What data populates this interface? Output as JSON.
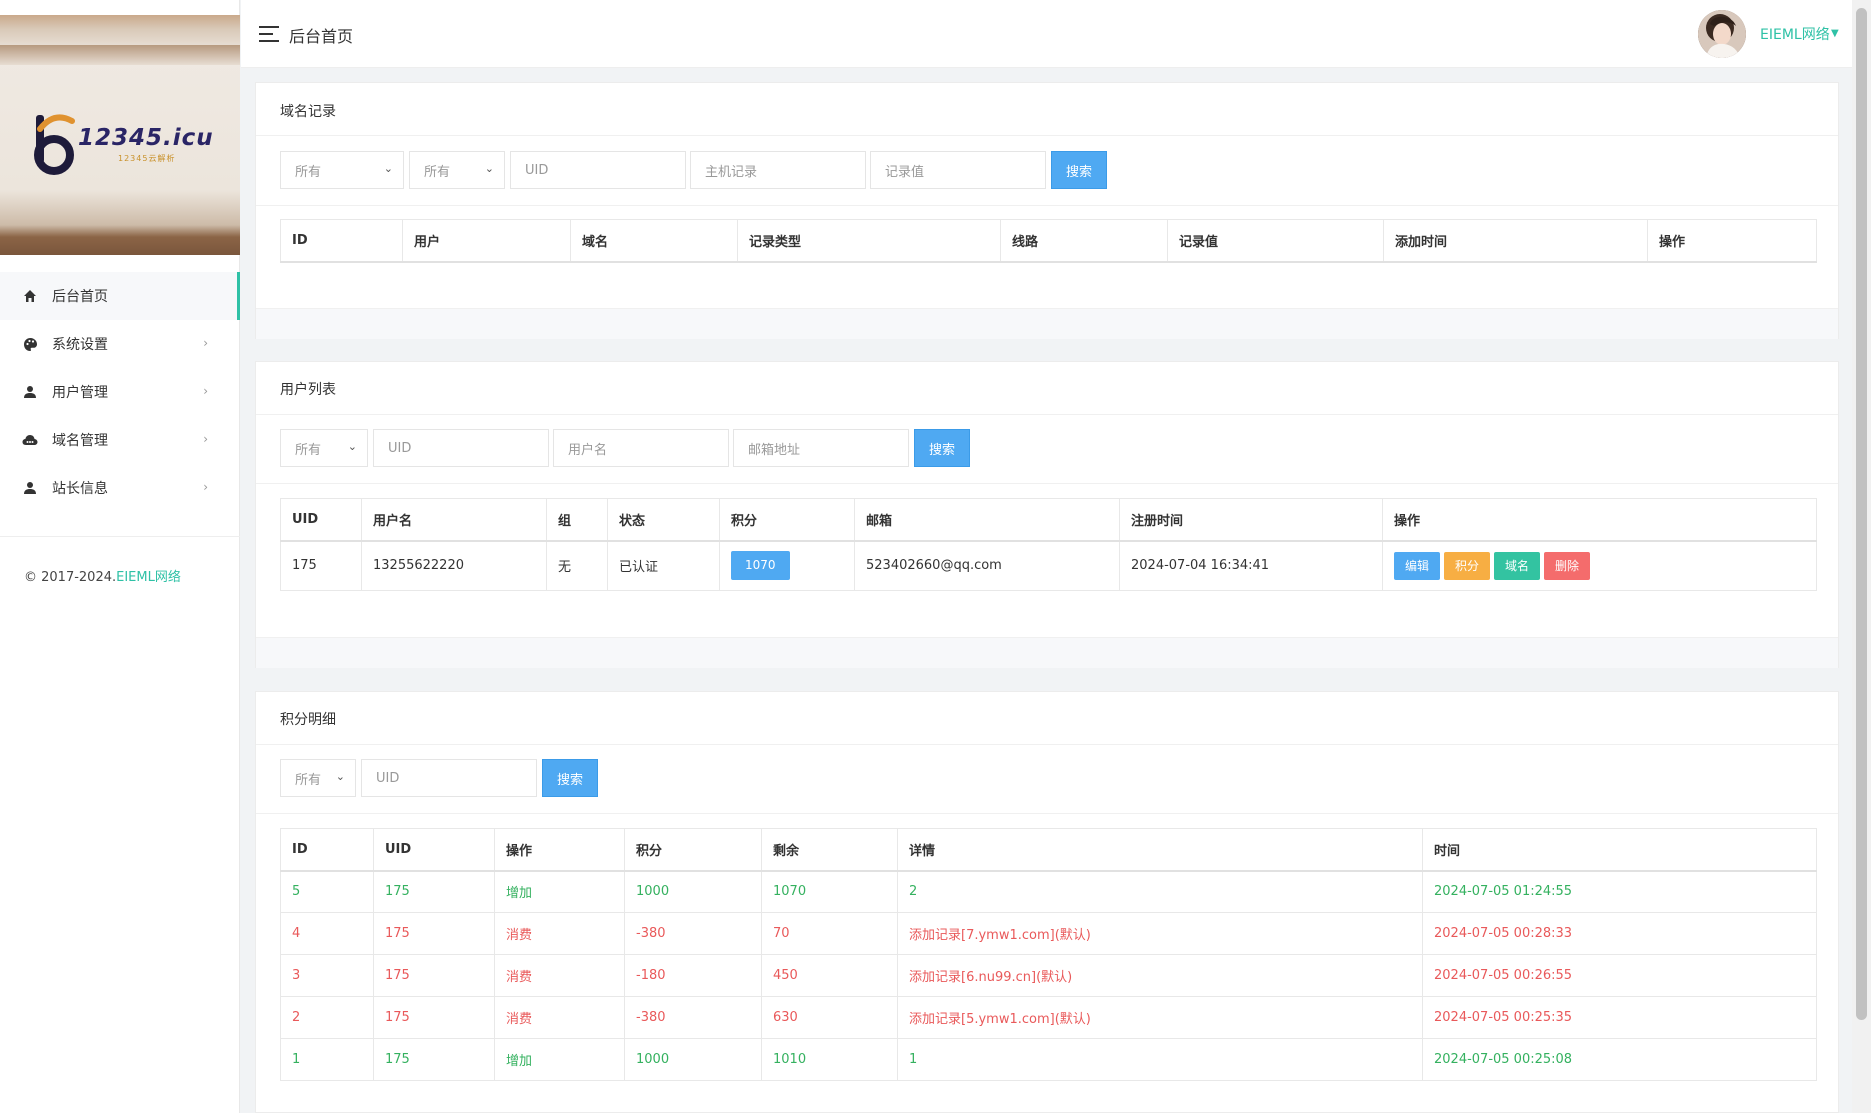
{
  "header": {
    "title": "后台首页",
    "user_name": "EIEML网络"
  },
  "logo": {
    "main": "12345.icu",
    "sub": "12345云解析"
  },
  "sidebar": {
    "items": [
      {
        "label": "后台首页",
        "icon": "home-icon",
        "active": true
      },
      {
        "label": "系统设置",
        "icon": "palette-icon"
      },
      {
        "label": "用户管理",
        "icon": "user-icon"
      },
      {
        "label": "域名管理",
        "icon": "cloud-icon"
      },
      {
        "label": "站长信息",
        "icon": "person-icon"
      }
    ],
    "copyright_prefix": "© 2017-2024.",
    "copyright_brand": "EIEML网络"
  },
  "domain_records": {
    "title": "域名记录",
    "filters": {
      "select1": "所有",
      "select2": "所有",
      "uid_placeholder": "UID",
      "host_placeholder": "主机记录",
      "value_placeholder": "记录值",
      "search_label": "搜索"
    },
    "columns": [
      "ID",
      "用户",
      "域名",
      "记录类型",
      "线路",
      "记录值",
      "添加时间",
      "操作"
    ],
    "rows": []
  },
  "user_list": {
    "title": "用户列表",
    "filters": {
      "select1": "所有",
      "uid_placeholder": "UID",
      "username_placeholder": "用户名",
      "email_placeholder": "邮箱地址",
      "search_label": "搜索"
    },
    "columns": [
      "UID",
      "用户名",
      "组",
      "状态",
      "积分",
      "邮箱",
      "注册时间",
      "操作"
    ],
    "rows": [
      {
        "uid": "175",
        "username": "13255622220",
        "group": "无",
        "status": "已认证",
        "points": "1070",
        "email": "523402660@qq.com",
        "registered": "2024-07-04 16:34:41",
        "actions": [
          "编辑",
          "积分",
          "域名",
          "删除"
        ]
      }
    ]
  },
  "points_detail": {
    "title": "积分明细",
    "filters": {
      "select1": "所有",
      "uid_placeholder": "UID",
      "search_label": "搜索"
    },
    "columns": [
      "ID",
      "UID",
      "操作",
      "积分",
      "剩余",
      "详情",
      "时间"
    ],
    "rows": [
      {
        "id": "5",
        "uid": "175",
        "op": "增加",
        "points": "1000",
        "remain": "1070",
        "detail": "2",
        "time": "2024-07-05 01:24:55",
        "type": "add"
      },
      {
        "id": "4",
        "uid": "175",
        "op": "消费",
        "points": "-380",
        "remain": "70",
        "detail": "添加记录[7.ymw1.com](默认)",
        "time": "2024-07-05 00:28:33",
        "type": "spend"
      },
      {
        "id": "3",
        "uid": "175",
        "op": "消费",
        "points": "-180",
        "remain": "450",
        "detail": "添加记录[6.nu99.cn](默认)",
        "time": "2024-07-05 00:26:55",
        "type": "spend"
      },
      {
        "id": "2",
        "uid": "175",
        "op": "消费",
        "points": "-380",
        "remain": "630",
        "detail": "添加记录[5.ymw1.com](默认)",
        "time": "2024-07-05 00:25:35",
        "type": "spend"
      },
      {
        "id": "1",
        "uid": "175",
        "op": "增加",
        "points": "1000",
        "remain": "1010",
        "detail": "1",
        "time": "2024-07-05 00:25:08",
        "type": "add"
      }
    ]
  },
  "colors": {
    "accent": "#2fc1a6",
    "primary": "#4fa9f2",
    "add": "#34b15f",
    "spend": "#e9595a"
  }
}
